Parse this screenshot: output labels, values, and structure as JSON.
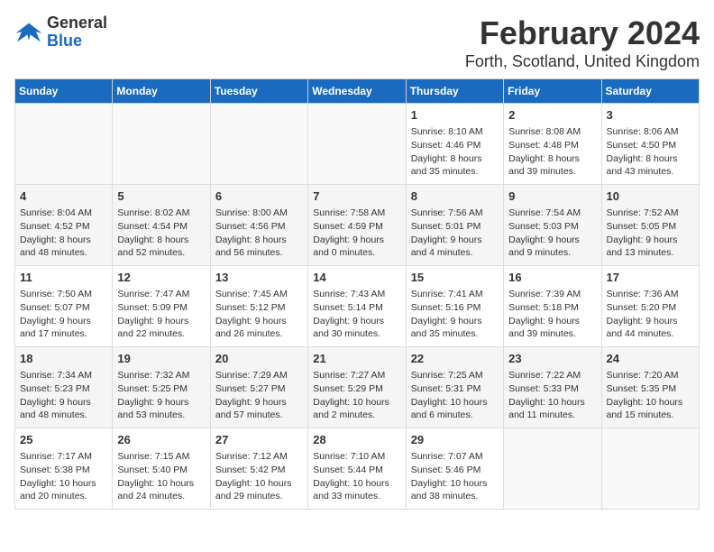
{
  "header": {
    "logo_line1": "General",
    "logo_line2": "Blue",
    "month": "February 2024",
    "location": "Forth, Scotland, United Kingdom"
  },
  "days_of_week": [
    "Sunday",
    "Monday",
    "Tuesday",
    "Wednesday",
    "Thursday",
    "Friday",
    "Saturday"
  ],
  "weeks": [
    [
      {
        "day": "",
        "sunrise": "",
        "sunset": "",
        "daylight": ""
      },
      {
        "day": "",
        "sunrise": "",
        "sunset": "",
        "daylight": ""
      },
      {
        "day": "",
        "sunrise": "",
        "sunset": "",
        "daylight": ""
      },
      {
        "day": "",
        "sunrise": "",
        "sunset": "",
        "daylight": ""
      },
      {
        "day": "1",
        "sunrise": "Sunrise: 8:10 AM",
        "sunset": "Sunset: 4:46 PM",
        "daylight": "Daylight: 8 hours and 35 minutes."
      },
      {
        "day": "2",
        "sunrise": "Sunrise: 8:08 AM",
        "sunset": "Sunset: 4:48 PM",
        "daylight": "Daylight: 8 hours and 39 minutes."
      },
      {
        "day": "3",
        "sunrise": "Sunrise: 8:06 AM",
        "sunset": "Sunset: 4:50 PM",
        "daylight": "Daylight: 8 hours and 43 minutes."
      }
    ],
    [
      {
        "day": "4",
        "sunrise": "Sunrise: 8:04 AM",
        "sunset": "Sunset: 4:52 PM",
        "daylight": "Daylight: 8 hours and 48 minutes."
      },
      {
        "day": "5",
        "sunrise": "Sunrise: 8:02 AM",
        "sunset": "Sunset: 4:54 PM",
        "daylight": "Daylight: 8 hours and 52 minutes."
      },
      {
        "day": "6",
        "sunrise": "Sunrise: 8:00 AM",
        "sunset": "Sunset: 4:56 PM",
        "daylight": "Daylight: 8 hours and 56 minutes."
      },
      {
        "day": "7",
        "sunrise": "Sunrise: 7:58 AM",
        "sunset": "Sunset: 4:59 PM",
        "daylight": "Daylight: 9 hours and 0 minutes."
      },
      {
        "day": "8",
        "sunrise": "Sunrise: 7:56 AM",
        "sunset": "Sunset: 5:01 PM",
        "daylight": "Daylight: 9 hours and 4 minutes."
      },
      {
        "day": "9",
        "sunrise": "Sunrise: 7:54 AM",
        "sunset": "Sunset: 5:03 PM",
        "daylight": "Daylight: 9 hours and 9 minutes."
      },
      {
        "day": "10",
        "sunrise": "Sunrise: 7:52 AM",
        "sunset": "Sunset: 5:05 PM",
        "daylight": "Daylight: 9 hours and 13 minutes."
      }
    ],
    [
      {
        "day": "11",
        "sunrise": "Sunrise: 7:50 AM",
        "sunset": "Sunset: 5:07 PM",
        "daylight": "Daylight: 9 hours and 17 minutes."
      },
      {
        "day": "12",
        "sunrise": "Sunrise: 7:47 AM",
        "sunset": "Sunset: 5:09 PM",
        "daylight": "Daylight: 9 hours and 22 minutes."
      },
      {
        "day": "13",
        "sunrise": "Sunrise: 7:45 AM",
        "sunset": "Sunset: 5:12 PM",
        "daylight": "Daylight: 9 hours and 26 minutes."
      },
      {
        "day": "14",
        "sunrise": "Sunrise: 7:43 AM",
        "sunset": "Sunset: 5:14 PM",
        "daylight": "Daylight: 9 hours and 30 minutes."
      },
      {
        "day": "15",
        "sunrise": "Sunrise: 7:41 AM",
        "sunset": "Sunset: 5:16 PM",
        "daylight": "Daylight: 9 hours and 35 minutes."
      },
      {
        "day": "16",
        "sunrise": "Sunrise: 7:39 AM",
        "sunset": "Sunset: 5:18 PM",
        "daylight": "Daylight: 9 hours and 39 minutes."
      },
      {
        "day": "17",
        "sunrise": "Sunrise: 7:36 AM",
        "sunset": "Sunset: 5:20 PM",
        "daylight": "Daylight: 9 hours and 44 minutes."
      }
    ],
    [
      {
        "day": "18",
        "sunrise": "Sunrise: 7:34 AM",
        "sunset": "Sunset: 5:23 PM",
        "daylight": "Daylight: 9 hours and 48 minutes."
      },
      {
        "day": "19",
        "sunrise": "Sunrise: 7:32 AM",
        "sunset": "Sunset: 5:25 PM",
        "daylight": "Daylight: 9 hours and 53 minutes."
      },
      {
        "day": "20",
        "sunrise": "Sunrise: 7:29 AM",
        "sunset": "Sunset: 5:27 PM",
        "daylight": "Daylight: 9 hours and 57 minutes."
      },
      {
        "day": "21",
        "sunrise": "Sunrise: 7:27 AM",
        "sunset": "Sunset: 5:29 PM",
        "daylight": "Daylight: 10 hours and 2 minutes."
      },
      {
        "day": "22",
        "sunrise": "Sunrise: 7:25 AM",
        "sunset": "Sunset: 5:31 PM",
        "daylight": "Daylight: 10 hours and 6 minutes."
      },
      {
        "day": "23",
        "sunrise": "Sunrise: 7:22 AM",
        "sunset": "Sunset: 5:33 PM",
        "daylight": "Daylight: 10 hours and 11 minutes."
      },
      {
        "day": "24",
        "sunrise": "Sunrise: 7:20 AM",
        "sunset": "Sunset: 5:35 PM",
        "daylight": "Daylight: 10 hours and 15 minutes."
      }
    ],
    [
      {
        "day": "25",
        "sunrise": "Sunrise: 7:17 AM",
        "sunset": "Sunset: 5:38 PM",
        "daylight": "Daylight: 10 hours and 20 minutes."
      },
      {
        "day": "26",
        "sunrise": "Sunrise: 7:15 AM",
        "sunset": "Sunset: 5:40 PM",
        "daylight": "Daylight: 10 hours and 24 minutes."
      },
      {
        "day": "27",
        "sunrise": "Sunrise: 7:12 AM",
        "sunset": "Sunset: 5:42 PM",
        "daylight": "Daylight: 10 hours and 29 minutes."
      },
      {
        "day": "28",
        "sunrise": "Sunrise: 7:10 AM",
        "sunset": "Sunset: 5:44 PM",
        "daylight": "Daylight: 10 hours and 33 minutes."
      },
      {
        "day": "29",
        "sunrise": "Sunrise: 7:07 AM",
        "sunset": "Sunset: 5:46 PM",
        "daylight": "Daylight: 10 hours and 38 minutes."
      },
      {
        "day": "",
        "sunrise": "",
        "sunset": "",
        "daylight": ""
      },
      {
        "day": "",
        "sunrise": "",
        "sunset": "",
        "daylight": ""
      }
    ]
  ]
}
